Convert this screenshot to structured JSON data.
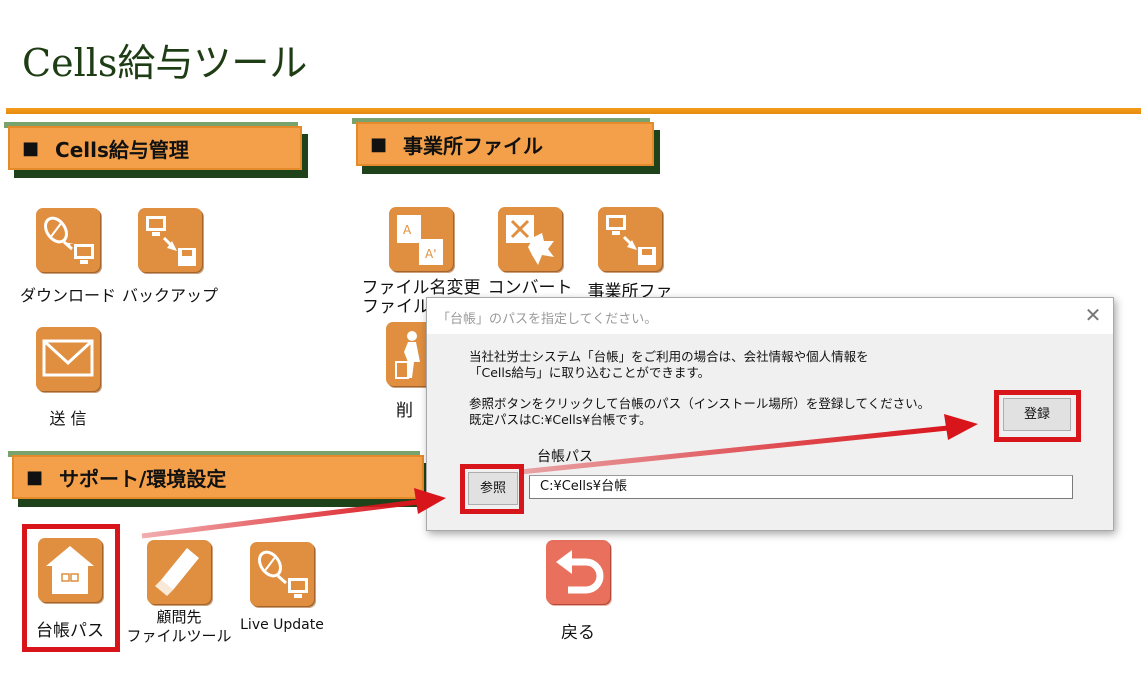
{
  "app": {
    "title": "Cells給与ツール"
  },
  "sections": {
    "payroll": "Cells給与管理",
    "office": "事業所ファイル",
    "support": "サポート/環境設定",
    "bullet": "■"
  },
  "tiles": {
    "download": "ダウンロード",
    "backup": "バックアップ",
    "send": "送 信",
    "rename_line1": "ファイル名変更",
    "rename_line2": "ファイル",
    "convert": "コンバート",
    "office_file": "事業所ファ",
    "delete": "削",
    "ledger_path": "台帳パス",
    "client_tool_line1": "顧問先",
    "client_tool_line2": "ファイルツール",
    "live_update": "Live Update",
    "back": "戻る"
  },
  "dialog": {
    "title": "「台帳」のパスを指定してください。",
    "close_glyph": "✕",
    "message_line1": "当社社労士システム「台帳」をご利用の場合は、会社情報や個人情報を",
    "message_line2": "「Cells給与」に取り込むことができます。",
    "message_line3": "参照ボタンをクリックして台帳のパス（インストール場所）を登録してください。",
    "message_line4": "既定パスはC:¥Cells¥台帳です。",
    "path_label": "台帳パス",
    "path_value": "C:¥Cells¥台帳",
    "browse_button": "参照",
    "register_button": "登録"
  },
  "colors": {
    "title_green": "#1e3d14",
    "accent_orange": "#f39b1b",
    "tile_orange": "#df8f3f",
    "highlight_red": "#d9151c",
    "back_tile_red": "#e8705d"
  },
  "icons": {
    "download": "satellite-to-monitor-icon",
    "backup": "monitor-to-disk-icon",
    "send": "envelope-icon",
    "rename": "document-rename-icon",
    "convert": "convert-icon",
    "office_file": "monitor-to-disk-icon",
    "delete": "trash-icon",
    "ledger_path": "house-icon",
    "client_tool": "usb-drive-icon",
    "live_update": "satellite-to-monitor-icon",
    "back": "return-arrow-icon"
  }
}
